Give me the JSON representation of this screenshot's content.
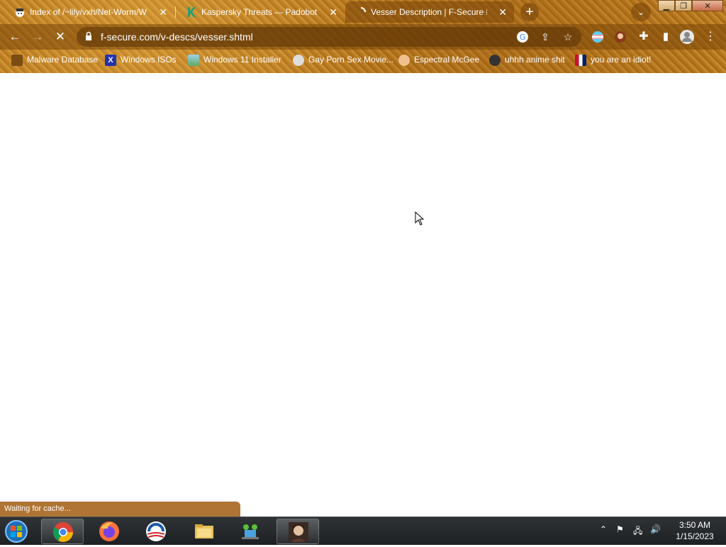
{
  "browser": {
    "tabs": [
      {
        "title": "Index of /~lily/vxh/Net-Worm/W",
        "favicon": "hat-icon"
      },
      {
        "title": "Kaspersky Threats — Padobot",
        "favicon": "kaspersky-k-icon"
      },
      {
        "title": "Vesser Description | F-Secure La",
        "favicon": "loading-spinner-icon"
      }
    ],
    "new_tab_label": "+",
    "url": "f-secure.com/v-descs/vesser.shtml",
    "bookmarks": [
      {
        "label": "Malware Database"
      },
      {
        "label": "Windows ISOs"
      },
      {
        "label": "Windows 11 Installer"
      },
      {
        "label": "Gay Porn Sex Movie..."
      },
      {
        "label": "Espectral McGee"
      },
      {
        "label": "uhhh anime shit"
      },
      {
        "label": "you are an idiot!"
      }
    ],
    "status_text": "Waiting for cache..."
  },
  "taskbar": {
    "apps": [
      "chrome",
      "firefox",
      "obama-logo",
      "file-explorer",
      "network-people",
      "portrait"
    ],
    "time": "3:50 AM",
    "date": "1/15/2023"
  },
  "colors": {
    "accent": "#b8781e",
    "taskbar": "#262a2d"
  }
}
